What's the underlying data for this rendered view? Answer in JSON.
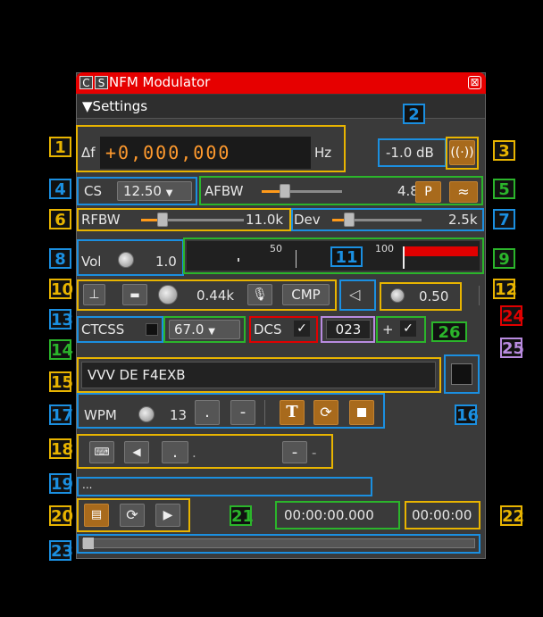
{
  "window": {
    "title": "NFM Modulator",
    "btn_c": "C",
    "btn_s": "S",
    "close_glyph": "⊠",
    "settings_label": "Settings",
    "settings_arrow": "▼"
  },
  "callouts": [
    "1",
    "2",
    "3",
    "4",
    "5",
    "6",
    "7",
    "8",
    "9",
    "10",
    "11",
    "12",
    "13",
    "14",
    "15",
    "16",
    "17",
    "18",
    "19",
    "20",
    "21",
    "22",
    "23",
    "24",
    "25",
    "26"
  ],
  "frequency": {
    "delta_label": "Δf",
    "digits": "+0,000,000",
    "unit": "Hz"
  },
  "power": {
    "value": "-1.0 dB",
    "icon": "antenna-icon"
  },
  "channel": {
    "cs_label": "CS",
    "spacing": "12.50",
    "afbw_label": "AFBW",
    "afbw_value": "4.8k",
    "afbw_slider": 0.2,
    "p_label": "P",
    "rfbw_label": "RFBW",
    "rfbw_value": "11.0k",
    "rfbw_slider": 0.2,
    "dev_label": "Dev",
    "dev_value": "2.5k",
    "dev_slider": 0.15
  },
  "volume": {
    "label": "Vol",
    "value": "1.0"
  },
  "meter": {
    "tick_50": "50",
    "tick_100": "100"
  },
  "input": {
    "tone_freq": "0.44k",
    "cmp_label": "CMP",
    "feedback_volume": "0.50"
  },
  "ctcss": {
    "label": "CTCSS",
    "value": "67.0"
  },
  "dcs": {
    "label": "DCS",
    "check": "✓",
    "code": "023",
    "sign": "+",
    "sign_check": "✓"
  },
  "cw": {
    "text": "VVV DE F4EXB",
    "wpm_label": "WPM",
    "wpm_value": "13",
    "dot": ".",
    "dash": "-",
    "t_label": "T",
    "keyer_dot_char": ".",
    "keyer_dash_char": "-",
    "status": "..."
  },
  "file": {
    "time_current": "00:00:00.000",
    "time_total": "00:00:00"
  },
  "colors": {
    "title_bar": "#e60000",
    "accent_orange": "#ff9a1a",
    "callout_yellow": "#e8b400",
    "callout_blue": "#1b8fe0",
    "callout_green": "#2bb52b",
    "callout_red": "#e00000",
    "callout_purple": "#b98be0"
  }
}
